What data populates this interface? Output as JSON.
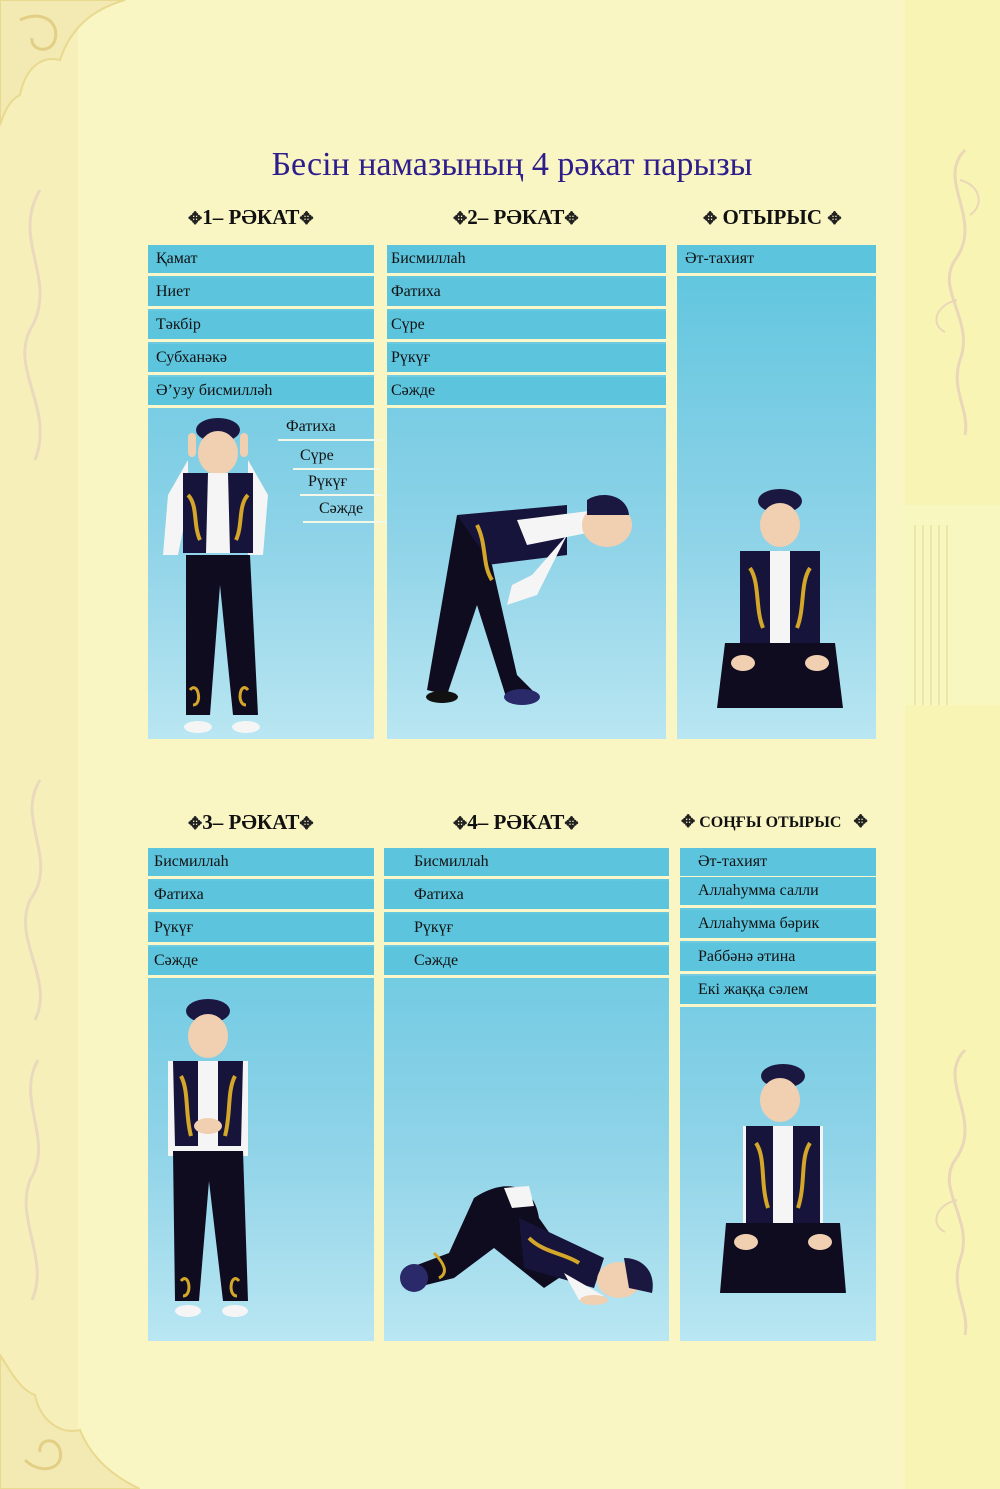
{
  "title": "Бесін намазының 4 рәкат парызы",
  "colors": {
    "cell": "#5cc4dd",
    "title": "#2e1e8c",
    "background": "#faf6c4"
  },
  "rakat1": {
    "heading": "1– РӘКАТ",
    "steps": [
      "Қамат",
      "Ниет",
      "Тәкбір",
      "Субханәкә",
      "Ә’узу бисмилләһ"
    ],
    "sub_steps": [
      "Фатиха",
      "Сүре",
      "Рүкүғ",
      "Сәжде"
    ]
  },
  "rakat2": {
    "heading": "2– РӘКАТ",
    "steps": [
      "Бисмиллаһ",
      "Фатиха",
      "Сүре",
      "Рүкүғ",
      "Сәжде"
    ]
  },
  "sitting1": {
    "heading": "ОТЫРЫС",
    "steps": [
      "Әт-тахият"
    ]
  },
  "rakat3": {
    "heading": "3– РӘКАТ",
    "steps": [
      "Бисмиллаһ",
      "Фатиха",
      "Рүкүғ",
      "Сәжде"
    ]
  },
  "rakat4": {
    "heading": "4– РӘКАТ",
    "steps": [
      "Бисмиллаһ",
      "Фатиха",
      "Рүкүғ",
      "Сәжде"
    ]
  },
  "sitting2": {
    "heading": "СОҢҒЫ ОТЫРЫС",
    "steps": [
      "Әт-тахият",
      "Аллаһумма салли",
      "Аллаһумма бәрик",
      "Раббәнә әтина",
      "Екі жаққа сәлем"
    ]
  }
}
